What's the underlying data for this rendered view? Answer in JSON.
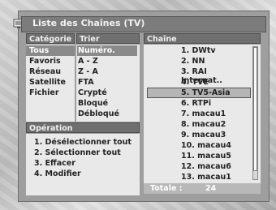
{
  "title": "Liste des Chaînes (TV)",
  "columns": {
    "category": "Catégorie",
    "sort": "Trier",
    "channel": "Chaîne"
  },
  "categories": [
    "Tous",
    "Favoris",
    "Réseau",
    "Satellite",
    "Fichier"
  ],
  "sort_options": [
    "Numéro.",
    "A - Z",
    "Z - A",
    "FTA",
    "Crypté",
    "Bloqué",
    "Débloqué"
  ],
  "operation": {
    "header": "Opération",
    "items": [
      "1. Désélectionner tout",
      "2. Sélectionner tout",
      "3. Effacer",
      "4. Modifier"
    ]
  },
  "channels": [
    "1. DWtv",
    "2. NN",
    "3. RAI Internat..",
    "4. TVE",
    "5. TV5-Asia",
    "6. RTPi",
    "7. macau1",
    "8. macau2",
    "9. macau3",
    "10. macau4",
    "11. macau5",
    "12. macau6",
    "13. macau1"
  ],
  "selected_channel_index": 4,
  "footer": {
    "label": "Totale :",
    "count": "24"
  }
}
